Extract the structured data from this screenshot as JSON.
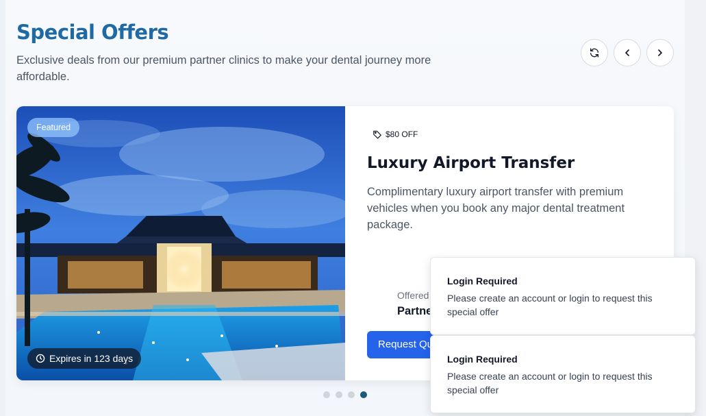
{
  "section": {
    "title": "Special Offers",
    "subtitle": "Exclusive deals from our premium partner clinics to make your dental journey more affordable."
  },
  "nav": {
    "refresh_icon": "refresh-icon",
    "prev_icon": "chevron-left-icon",
    "next_icon": "chevron-right-icon"
  },
  "offer": {
    "featured": "Featured",
    "expires": "Expires in 123 days",
    "discount": "$80 OFF",
    "title": "Luxury Airport Transfer",
    "description": "Complimentary luxury airport transfer with premium vehicles when you book any major dental treatment package.",
    "offered_label": "Offered",
    "partner": "Partne",
    "cta": "Request Qu"
  },
  "carousel": {
    "total": 4,
    "active_index": 3
  },
  "toasts": [
    {
      "title": "Login Required",
      "message": "Please create an account or login to request this special offer"
    },
    {
      "title": "Login Required",
      "message": "Please create an account or login to request this special offer"
    }
  ],
  "colors": {
    "title": "#1f6aa5",
    "primary": "#2563eb",
    "dot_active": "#1b5a7a",
    "dot_inactive": "#d1d5db"
  }
}
